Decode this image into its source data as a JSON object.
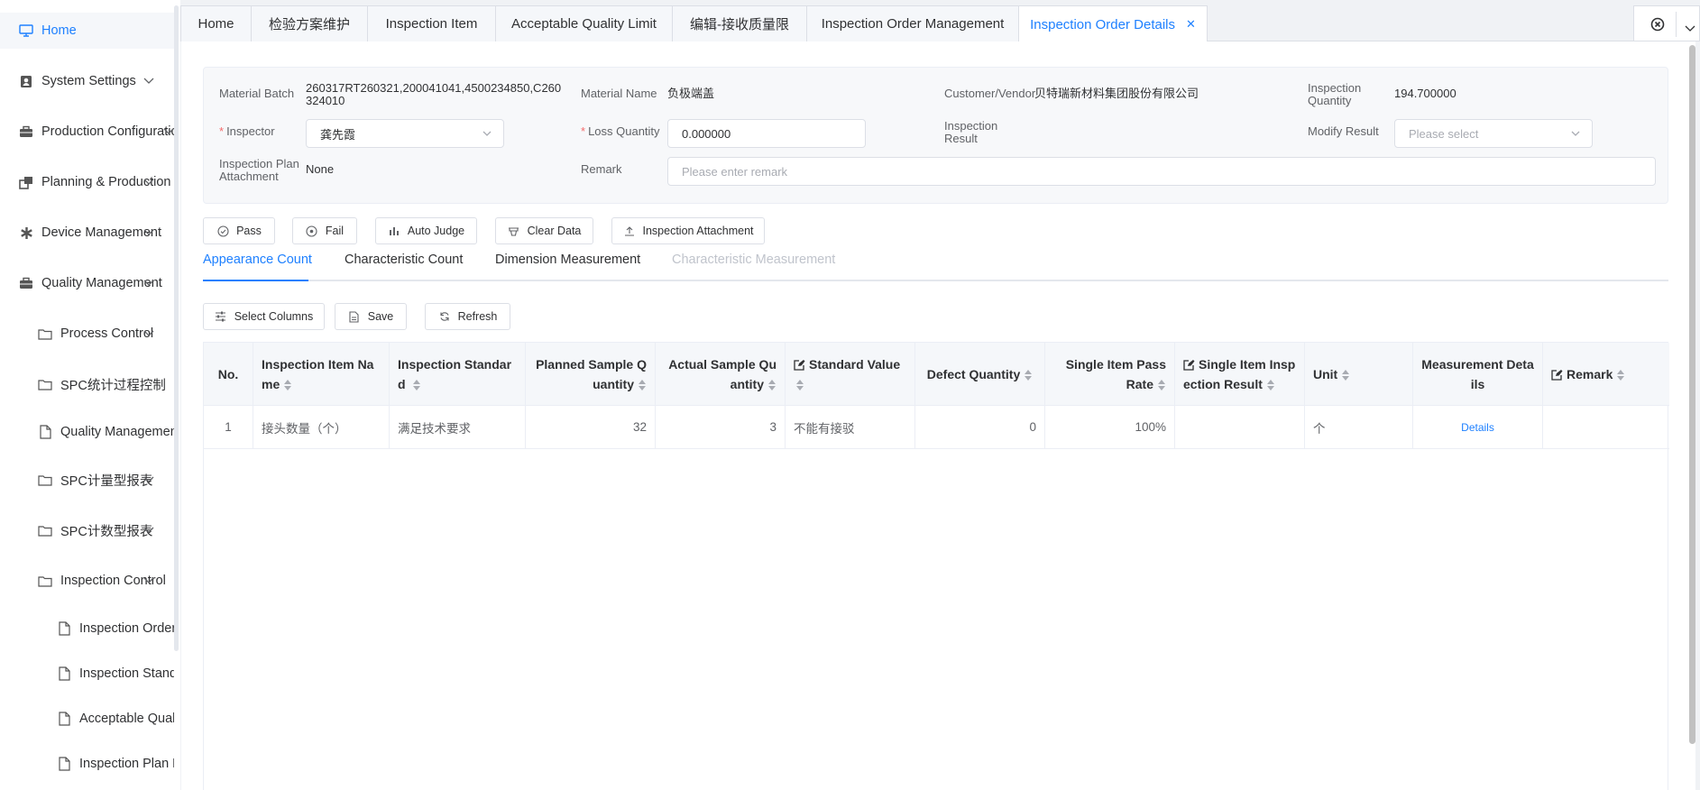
{
  "sidebar": {
    "items": [
      {
        "label": "Home"
      },
      {
        "label": "System Settings"
      },
      {
        "label": "Production Configuration"
      },
      {
        "label": "Planning & Production"
      },
      {
        "label": "Device Management"
      },
      {
        "label": "Quality Management"
      },
      {
        "label": "Process Control"
      },
      {
        "label": "SPC统计过程控制"
      },
      {
        "label": "Quality Management Report"
      },
      {
        "label": "SPC计量型报表"
      },
      {
        "label": "SPC计数型报表"
      },
      {
        "label": "Inspection Control"
      },
      {
        "label": "Inspection Order Management"
      },
      {
        "label": "Inspection Standard"
      },
      {
        "label": "Acceptable Quality Limit"
      },
      {
        "label": "Inspection Plan Maintenance"
      }
    ]
  },
  "tabs": [
    {
      "label": "Home"
    },
    {
      "label": "检验方案维护"
    },
    {
      "label": "Inspection Item"
    },
    {
      "label": "Acceptable Quality Limit"
    },
    {
      "label": "编辑-接收质量限"
    },
    {
      "label": "Inspection Order Management"
    },
    {
      "label": "Inspection Order Details"
    }
  ],
  "form": {
    "material_batch_label": "Material Batch",
    "material_batch_value": "260317RT260321,200041041,4500234850,C260324010",
    "material_name_label": "Material Name",
    "material_name_value": "负极端盖",
    "customer_label": "Customer/Vendor",
    "customer_value": "贝特瑞新材料集团股份有限公司",
    "inspection_quantity_label": "Inspection Quantity",
    "inspection_quantity_value": "194.700000",
    "inspector_label": "Inspector",
    "inspector_value": "龚先霞",
    "loss_quantity_label": "Loss Quantity",
    "loss_quantity_value": "0.000000",
    "inspection_result_label": "Inspection Result",
    "modify_result_label": "Modify Result",
    "modify_result_placeholder": "Please select",
    "plan_attachment_label": "Inspection Plan Attachment",
    "plan_attachment_value": "None",
    "remark_label": "Remark",
    "remark_placeholder": "Please enter remark"
  },
  "actions": {
    "pass": "Pass",
    "fail": "Fail",
    "auto_judge": "Auto Judge",
    "clear_data": "Clear Data",
    "inspection_attachment": "Inspection Attachment"
  },
  "subtabs": [
    {
      "label": "Appearance Count"
    },
    {
      "label": "Characteristic Count"
    },
    {
      "label": "Dimension Measurement"
    },
    {
      "label": "Characteristic Measurement"
    }
  ],
  "toolbar": {
    "select_columns": "Select Columns",
    "save": "Save",
    "refresh": "Refresh"
  },
  "table": {
    "headers": [
      "No.",
      "Inspection Item Name",
      "Inspection Standard",
      "Planned Sample Quantity",
      "Actual Sample Quantity",
      "Standard Value",
      "Defect Quantity",
      "Single Item Pass Rate",
      "Single Item Inspection Result",
      "Unit",
      "Measurement Details",
      "Remark"
    ],
    "rows": [
      {
        "no": "1",
        "item_name": "接头数量（个）",
        "standard": "满足技术要求",
        "planned": "32",
        "actual": "3",
        "standard_value": "不能有接驳",
        "defect": "0",
        "pass_rate": "100%",
        "result": "",
        "unit": "个",
        "details": "Details",
        "remark": ""
      }
    ]
  },
  "colors": {
    "accent": "#1e80ff",
    "required": "#f56c6c"
  }
}
